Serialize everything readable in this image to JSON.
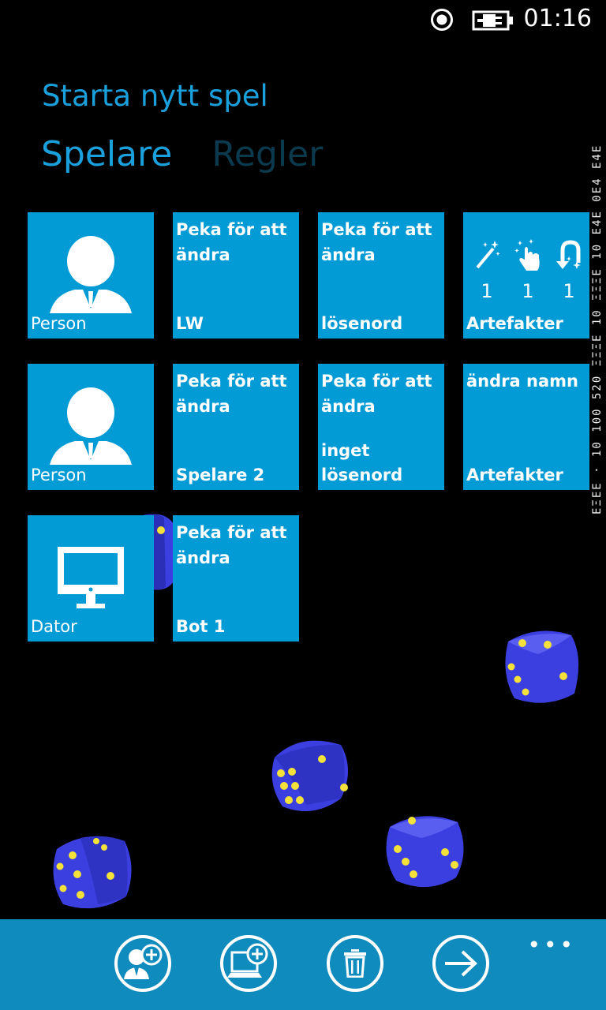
{
  "status": {
    "time": "01:16",
    "icons": [
      "radio-icon",
      "battery-charging-icon"
    ]
  },
  "debug_strip": {
    "text": "EΞEE · 10 100 520 ΞΞΞE 10 ΞΞΞE 10 E4E 0E4 E4E"
  },
  "header": {
    "title": "Starta nytt spel",
    "pivots": [
      "Spelare",
      "Regler"
    ]
  },
  "players": [
    {
      "type_label": "Person",
      "name_hint": "Peka för att ändra",
      "name": "LW",
      "password_hint": "Peka för att ändra",
      "password": "lösenord",
      "artifacts_label": "Artefakter",
      "artifacts": [
        {
          "icon": "magic-wand-icon",
          "count": "1"
        },
        {
          "icon": "tap-hand-icon",
          "count": "1"
        },
        {
          "icon": "undo-magnet-icon",
          "count": "1"
        }
      ]
    },
    {
      "type_label": "Person",
      "name_hint": "Peka för att ändra",
      "name": "Spelare 2",
      "password_hint": "Peka för att ändra",
      "password_state": "inget",
      "password": "lösenord",
      "artifacts_top": "ändra namn",
      "artifacts_label": "Artefakter"
    },
    {
      "type_label": "Dator",
      "name_hint": "Peka för att ändra",
      "name": "Bot 1"
    }
  ],
  "appbar": {
    "buttons": [
      {
        "icon": "add-person-icon",
        "action": "add-human"
      },
      {
        "icon": "add-computer-icon",
        "action": "add-bot"
      },
      {
        "icon": "trash-icon",
        "action": "delete"
      },
      {
        "icon": "arrow-right-icon",
        "action": "next"
      }
    ],
    "more": "•••"
  },
  "colors": {
    "accent": "#1aa0dc",
    "tile": "#029bd5",
    "appbar": "#0f8bbd",
    "die_body": "#3b3fe0",
    "die_pip": "#f4e23a"
  }
}
